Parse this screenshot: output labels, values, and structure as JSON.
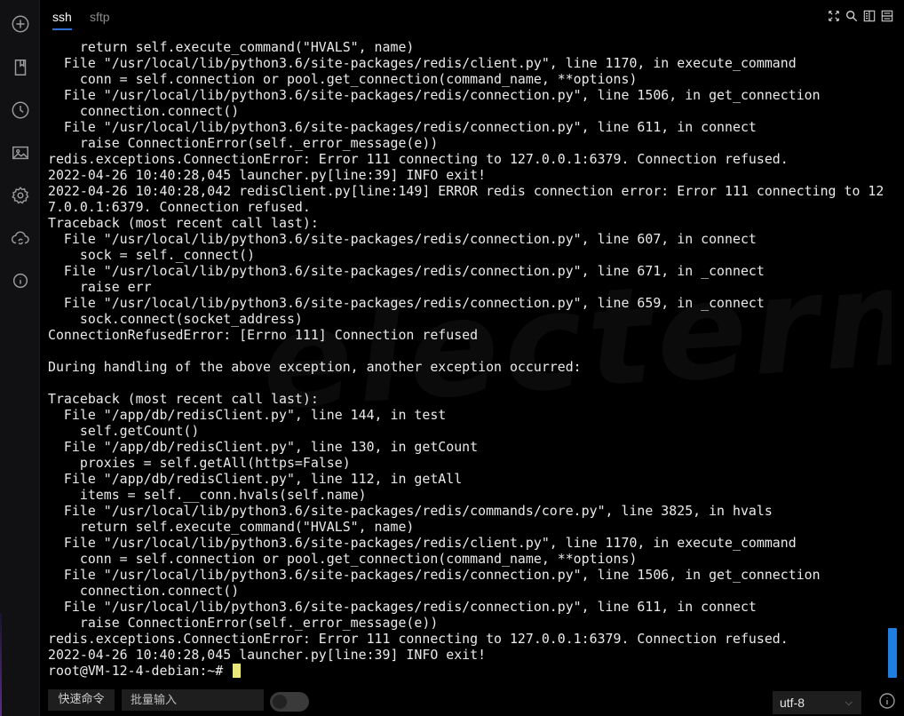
{
  "sidebar": {
    "icons": [
      "add-icon",
      "bookmark-icon",
      "history-icon",
      "image-icon",
      "settings-icon",
      "cloud-sync-icon",
      "info-icon"
    ]
  },
  "tabs": [
    {
      "label": "ssh",
      "active": true
    },
    {
      "label": "sftp",
      "active": false
    }
  ],
  "toolbar": {
    "icons": [
      "fullscreen-icon",
      "search-icon",
      "split-vertical-icon",
      "split-horizontal-icon"
    ]
  },
  "watermark": "electerm",
  "terminal": {
    "lines": [
      "    return self.execute_command(\"HVALS\", name)",
      "  File \"/usr/local/lib/python3.6/site-packages/redis/client.py\", line 1170, in execute_command",
      "    conn = self.connection or pool.get_connection(command_name, **options)",
      "  File \"/usr/local/lib/python3.6/site-packages/redis/connection.py\", line 1506, in get_connection",
      "    connection.connect()",
      "  File \"/usr/local/lib/python3.6/site-packages/redis/connection.py\", line 611, in connect",
      "    raise ConnectionError(self._error_message(e))",
      "redis.exceptions.ConnectionError: Error 111 connecting to 127.0.0.1:6379. Connection refused.",
      "2022-04-26 10:40:28,045 launcher.py[line:39] INFO exit!",
      "2022-04-26 10:40:28,042 redisClient.py[line:149] ERROR redis connection error: Error 111 connecting to 12",
      "7.0.0.1:6379. Connection refused.",
      "Traceback (most recent call last):",
      "  File \"/usr/local/lib/python3.6/site-packages/redis/connection.py\", line 607, in connect",
      "    sock = self._connect()",
      "  File \"/usr/local/lib/python3.6/site-packages/redis/connection.py\", line 671, in _connect",
      "    raise err",
      "  File \"/usr/local/lib/python3.6/site-packages/redis/connection.py\", line 659, in _connect",
      "    sock.connect(socket_address)",
      "ConnectionRefusedError: [Errno 111] Connection refused",
      "",
      "During handling of the above exception, another exception occurred:",
      "",
      "Traceback (most recent call last):",
      "  File \"/app/db/redisClient.py\", line 144, in test",
      "    self.getCount()",
      "  File \"/app/db/redisClient.py\", line 130, in getCount",
      "    proxies = self.getAll(https=False)",
      "  File \"/app/db/redisClient.py\", line 112, in getAll",
      "    items = self.__conn.hvals(self.name)",
      "  File \"/usr/local/lib/python3.6/site-packages/redis/commands/core.py\", line 3825, in hvals",
      "    return self.execute_command(\"HVALS\", name)",
      "  File \"/usr/local/lib/python3.6/site-packages/redis/client.py\", line 1170, in execute_command",
      "    conn = self.connection or pool.get_connection(command_name, **options)",
      "  File \"/usr/local/lib/python3.6/site-packages/redis/connection.py\", line 1506, in get_connection",
      "    connection.connect()",
      "  File \"/usr/local/lib/python3.6/site-packages/redis/connection.py\", line 611, in connect",
      "    raise ConnectionError(self._error_message(e))",
      "redis.exceptions.ConnectionError: Error 111 connecting to 127.0.0.1:6379. Connection refused.",
      "2022-04-26 10:40:28,045 launcher.py[line:39] INFO exit!"
    ],
    "prompt": "root@VM-12-4-debian:~# "
  },
  "bottombar": {
    "quick_command_label": "快速命令",
    "batch_input_placeholder": "批量输入",
    "encoding_value": "utf-8"
  },
  "colors": {
    "accent": "#2f6fd6",
    "scrollbar": "#1f7fe0",
    "cursor": "#e8e67a",
    "text": "#eaeaea"
  }
}
